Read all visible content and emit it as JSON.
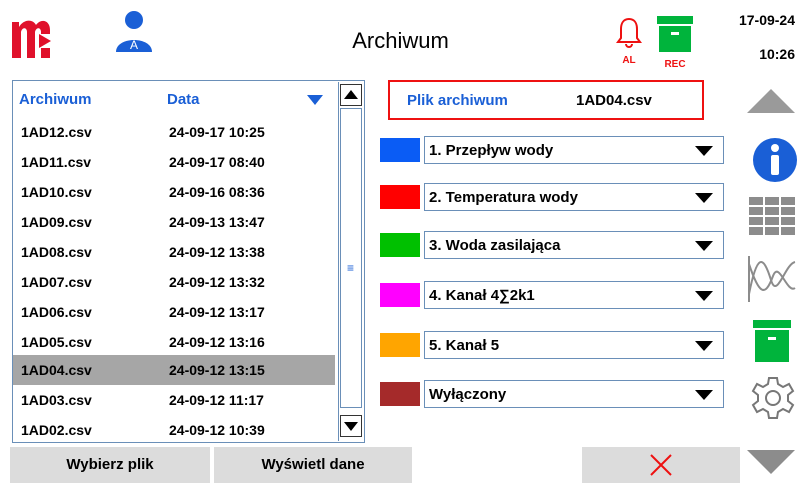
{
  "header": {
    "title": "Archiwum",
    "user_badge": "A",
    "alarm_label": "AL",
    "rec_label": "REC",
    "date": "17-09-24",
    "time": "10:26"
  },
  "file_list": {
    "col_archive": "Archiwum",
    "col_date": "Data",
    "rows": [
      {
        "name": "1AD12.csv",
        "date": "24-09-17 10:25"
      },
      {
        "name": "1AD11.csv",
        "date": "24-09-17 08:40"
      },
      {
        "name": "1AD10.csv",
        "date": "24-09-16 08:36"
      },
      {
        "name": "1AD09.csv",
        "date": "24-09-13 13:47"
      },
      {
        "name": "1AD08.csv",
        "date": "24-09-12 13:38"
      },
      {
        "name": "1AD07.csv",
        "date": "24-09-12 13:32"
      },
      {
        "name": "1AD06.csv",
        "date": "24-09-12 13:17"
      },
      {
        "name": "1AD05.csv",
        "date": "24-09-12 13:16"
      },
      {
        "name": "1AD04.csv",
        "date": "24-09-12 13:15"
      },
      {
        "name": "1AD03.csv",
        "date": "24-09-12 11:17"
      },
      {
        "name": "1AD02.csv",
        "date": "24-09-12 10:39"
      }
    ],
    "selected_index": 8
  },
  "archive_file": {
    "label": "Plik archiwum",
    "value": "1AD04.csv"
  },
  "channels": [
    {
      "color": "#0a5cf5",
      "label": "1. Przepływ wody"
    },
    {
      "color": "#ff0000",
      "label": "2. Temperatura wody"
    },
    {
      "color": "#00c000",
      "label": "3. Woda zasilająca"
    },
    {
      "color": "#ff00ff",
      "label": "4. Kanał 4∑2k1"
    },
    {
      "color": "#ffa500",
      "label": "5. Kanał 5"
    },
    {
      "color": "#a52a2a",
      "label": "Wyłączony"
    }
  ],
  "buttons": {
    "select_file": "Wybierz plik",
    "show_data": "Wyświetl dane"
  },
  "colors": {
    "accent_blue": "#1a5fd6",
    "logo_red": "#e0112b",
    "rec_green": "#00b43c",
    "selection_gray": "#a6a6a6"
  }
}
